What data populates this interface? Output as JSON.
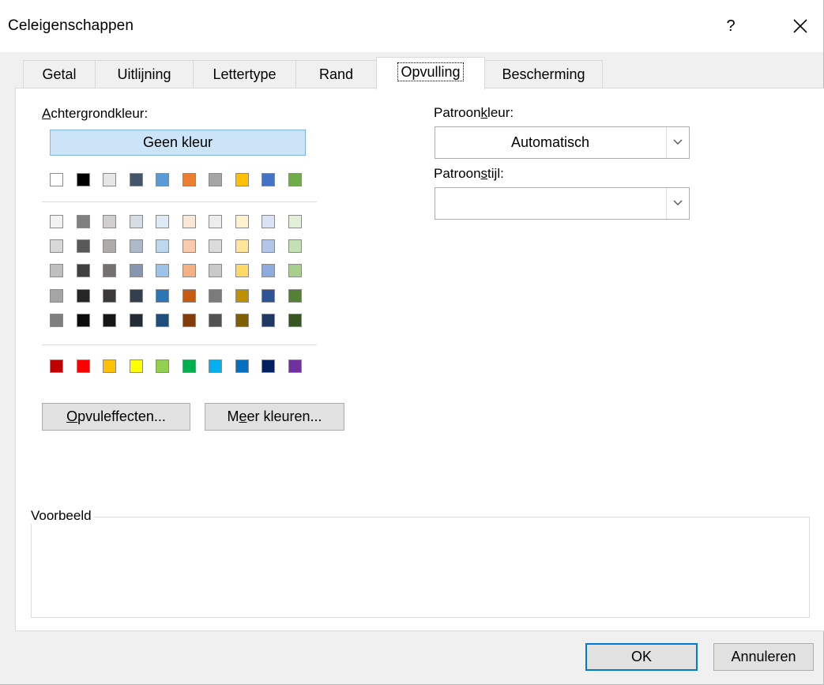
{
  "window": {
    "title": "Celeigenschappen",
    "help_label": "?",
    "close_icon": "close-icon"
  },
  "tabs": [
    {
      "label": "Getal",
      "active": false
    },
    {
      "label": "Uitlijning",
      "active": false
    },
    {
      "label": "Lettertype",
      "active": false
    },
    {
      "label": "Rand",
      "active": false
    },
    {
      "label": "Opvulling",
      "active": true
    },
    {
      "label": "Bescherming",
      "active": false
    }
  ],
  "background": {
    "label_accel": "A",
    "label_rest": "chtergrondkleur:",
    "no_color_label": "Geen kleur",
    "theme_top_row": [
      "#ffffff",
      "#000000",
      "#e7e6e6",
      "#44546a",
      "#5b9bd5",
      "#ed7d31",
      "#a5a5a5",
      "#ffc000",
      "#4472c4",
      "#70ad47"
    ],
    "theme_shades": [
      [
        "#f2f2f2",
        "#808080",
        "#d0cece",
        "#d6dce4",
        "#deebf6",
        "#fbe5d5",
        "#ededed",
        "#fff2cc",
        "#dae3f3",
        "#e2efd9"
      ],
      [
        "#d8d8d8",
        "#595959",
        "#aeabab",
        "#adb9ca",
        "#bdd7ee",
        "#f8cbad",
        "#dbdbdb",
        "#fee599",
        "#b4c6e7",
        "#c5e0b3"
      ],
      [
        "#bfbfbf",
        "#3f3f3f",
        "#757070",
        "#8496b0",
        "#9dc3e6",
        "#f4b183",
        "#c9c9c9",
        "#ffd965",
        "#8faadc",
        "#a8d08d"
      ],
      [
        "#a5a5a5",
        "#262626",
        "#3a3838",
        "#323f4f",
        "#2e75b5",
        "#c55a11",
        "#7b7b7b",
        "#bf9000",
        "#2f5496",
        "#538135"
      ],
      [
        "#7f7f7f",
        "#0c0c0c",
        "#171616",
        "#222a35",
        "#1e4e79",
        "#833c0b",
        "#525252",
        "#7f6000",
        "#1f3864",
        "#375623"
      ]
    ],
    "standard_colors": [
      "#c00000",
      "#ff0000",
      "#ffc000",
      "#ffff00",
      "#92d050",
      "#00b050",
      "#00b0f0",
      "#0070c0",
      "#002060",
      "#7030a0"
    ],
    "fill_effects_accel": "O",
    "fill_effects_rest": "pvuleffecten...",
    "more_colors_pre": "M",
    "more_colors_accel": "e",
    "more_colors_rest": "er kleuren..."
  },
  "pattern": {
    "color_label_pre": "Patroon",
    "color_label_accel": "k",
    "color_label_rest": "leur:",
    "color_value": "Automatisch",
    "style_label_pre": "Patroon",
    "style_label_accel": "s",
    "style_label_rest": "tijl:",
    "style_value": ""
  },
  "preview": {
    "legend": "Voorbeeld"
  },
  "buttons": {
    "ok": "OK",
    "cancel": "Annuleren"
  }
}
